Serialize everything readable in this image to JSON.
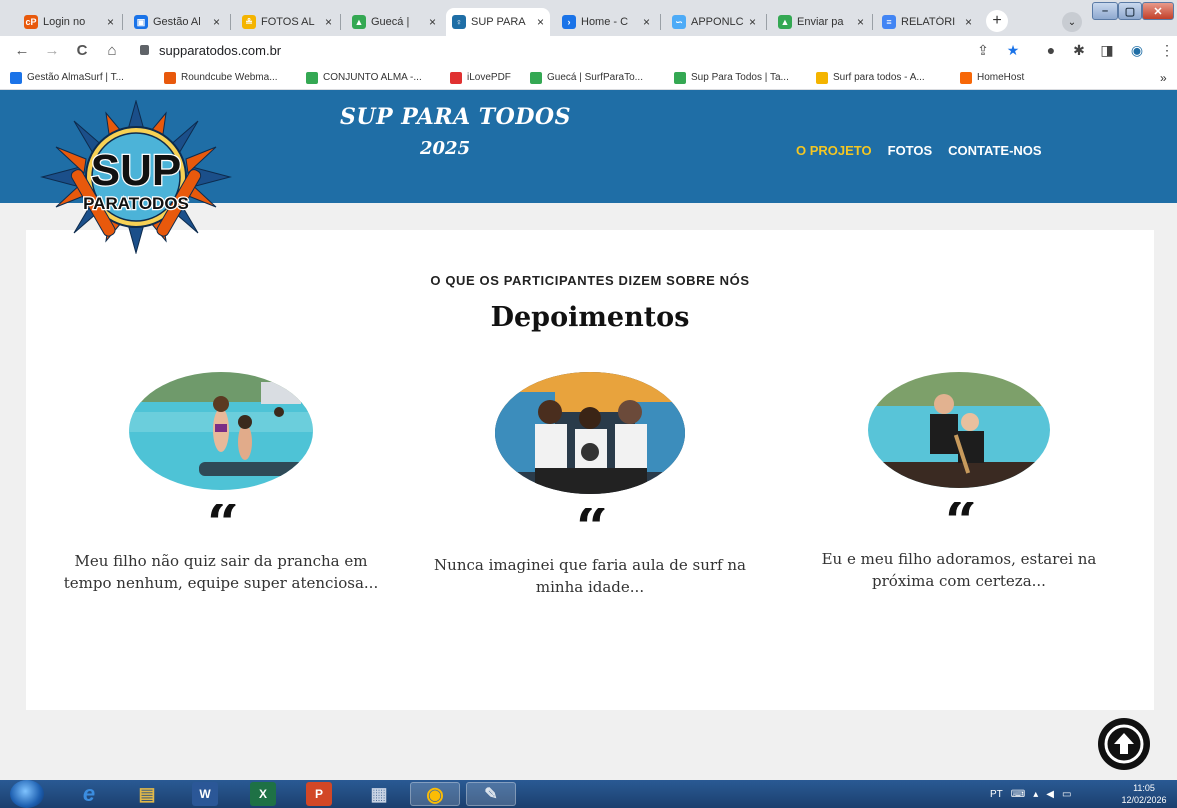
{
  "browser": {
    "tabs": [
      {
        "title": "Login no",
        "favicon_color": "#e8590c",
        "favicon_glyph": "cP"
      },
      {
        "title": "Gestão Al",
        "favicon_color": "#1a73e8",
        "favicon_glyph": "▣"
      },
      {
        "title": "FOTOS AL",
        "favicon_color": "#f4b400",
        "favicon_glyph": "≗"
      },
      {
        "title": "Guecá |",
        "favicon_color": "#34a853",
        "favicon_glyph": "▲"
      },
      {
        "title": "SUP PARA",
        "favicon_color": "#1f6ea6",
        "favicon_glyph": "♀",
        "active": true
      },
      {
        "title": "Home - C",
        "favicon_color": "#1a73e8",
        "favicon_glyph": "›"
      },
      {
        "title": "APPONLC",
        "favicon_color": "#4dabf7",
        "favicon_glyph": "∽"
      },
      {
        "title": "Enviar pa",
        "favicon_color": "#34a853",
        "favicon_glyph": "▲"
      },
      {
        "title": "RELATÓRI",
        "favicon_color": "#4285f4",
        "favicon_glyph": "≡"
      }
    ],
    "close_glyph": "×",
    "new_tab_glyph": "+",
    "tab_search_glyph": "⌄",
    "window_controls": [
      "–",
      "▢",
      "✕"
    ],
    "nav": {
      "back": "←",
      "forward": "→",
      "reload": "C",
      "home": "⌂"
    },
    "url": "supparatodos.com.br",
    "toolbar_icons": [
      "share-icon",
      "star-icon",
      "profile-icon",
      "extensions-icon",
      "sidepanel-icon",
      "avatar-icon",
      "menu-icon"
    ],
    "toolbar_glyphs": [
      "⇪",
      "★",
      "●",
      "✱",
      "◨",
      "◉",
      "⋮"
    ],
    "bookmarks": [
      {
        "label": "Gestão AlmaSurf | T...",
        "color": "#1a73e8"
      },
      {
        "label": "Roundcube Webma...",
        "color": "#e8590c"
      },
      {
        "label": "CONJUNTO ALMA -...",
        "color": "#34a853"
      },
      {
        "label": "iLovePDF",
        "color": "#e03131"
      },
      {
        "label": "Guecá | SurfParaTo...",
        "color": "#34a853"
      },
      {
        "label": "Sup Para Todos | Ta...",
        "color": "#34a853"
      },
      {
        "label": "Surf para todos - A...",
        "color": "#f4b400"
      },
      {
        "label": "HomeHost",
        "color": "#f76707"
      }
    ],
    "bookmarks_overflow": "»"
  },
  "site": {
    "title": "SUP PARA TODOS",
    "year": "2025",
    "logo_text_top": "SUP",
    "logo_text_bottom": "PARATODOS",
    "nav": [
      {
        "label": "O PROJETO",
        "active": true
      },
      {
        "label": "FOTOS",
        "active": false
      },
      {
        "label": "CONTATE-NOS",
        "active": false
      }
    ],
    "colors": {
      "header": "#1f6ea6",
      "nav_active": "#f3c623",
      "text": "#333333"
    }
  },
  "testimonials_section": {
    "kicker": "O QUE OS PARTICIPANTES DIZEM SOBRE NÓS",
    "heading": "Depoimentos",
    "quote_glyph": "“",
    "items": [
      {
        "text": "Meu filho não quiz sair da prancha em tempo nenhum, equipe super atenciosa..."
      },
      {
        "text": "Nunca imaginei que faria aula de surf na minha idade..."
      },
      {
        "text": "Eu e meu filho adoramos, estarei na próxima com certeza..."
      }
    ]
  },
  "back_to_top_icon": "arrow-up-circle-icon",
  "taskbar": {
    "apps": [
      {
        "name": "ie",
        "label": "e",
        "color": "#3b8de0"
      },
      {
        "name": "explorer",
        "label": "▤",
        "color": "#e0b84a"
      },
      {
        "name": "word",
        "label": "W",
        "color": "#2b5797"
      },
      {
        "name": "excel",
        "label": "X",
        "color": "#1e7145"
      },
      {
        "name": "powerpoint",
        "label": "P",
        "color": "#d24726"
      },
      {
        "name": "calculator",
        "label": "▦",
        "color": "#8a9bb5"
      },
      {
        "name": "chrome",
        "label": "◉",
        "color": "#4285f4"
      },
      {
        "name": "paint",
        "label": "✎",
        "color": "#6c7a89"
      }
    ],
    "language": "PT",
    "time": "11:05",
    "date": "12/02/2026"
  }
}
